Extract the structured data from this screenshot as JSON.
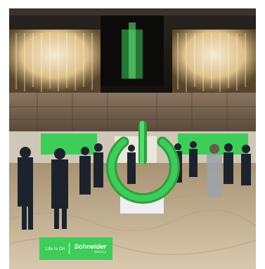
{
  "photo": {
    "scene": "Conference foyer with chandeliers, attendees and a green power-button sculpture",
    "colors": {
      "brand_green": "#3dcd58",
      "ceiling_dark": "#1c1a17",
      "carpet": "#c9b89c",
      "wall": "#6b5a48"
    }
  },
  "badge": {
    "tagline": "Life Is On",
    "logo_name": "Schneider",
    "logo_sub": "Electric"
  }
}
